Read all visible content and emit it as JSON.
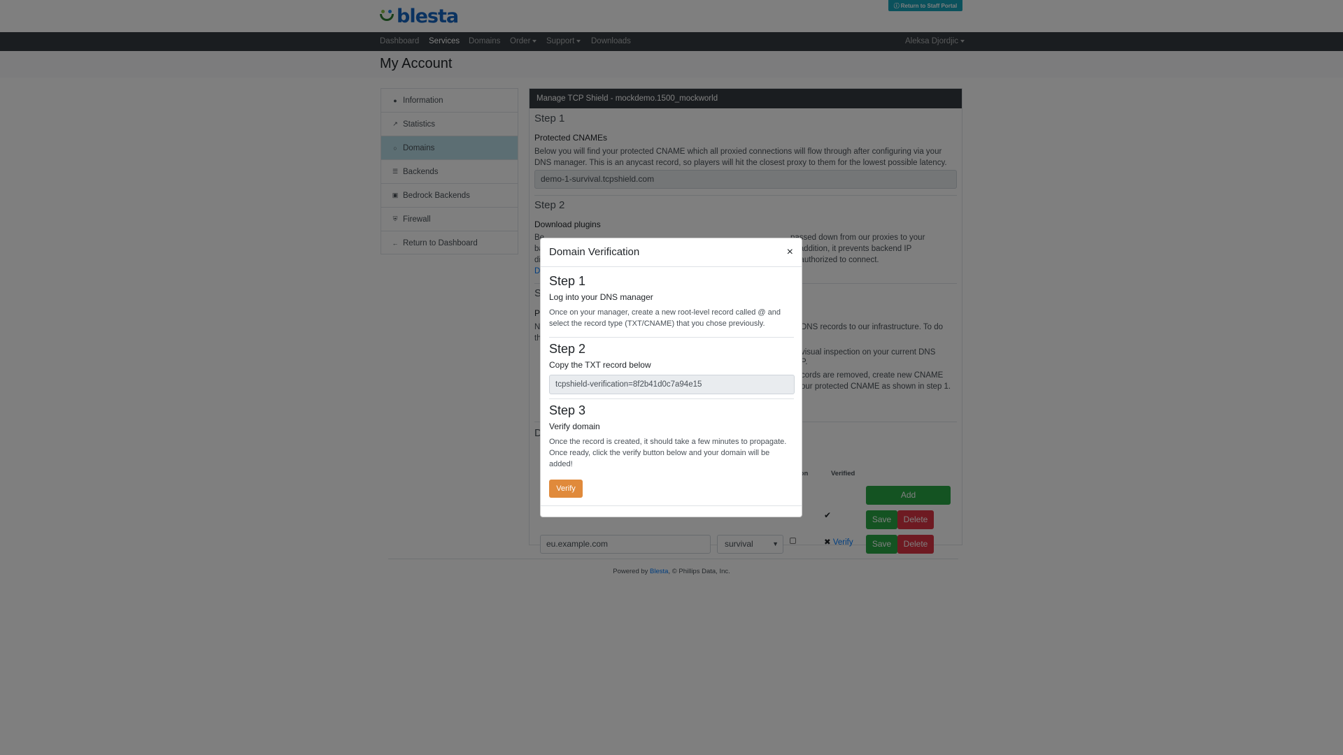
{
  "header": {
    "logo_text": "blesta",
    "staff_portal": "Return to Staff Portal"
  },
  "nav": {
    "items": [
      "Dashboard",
      "Services",
      "Domains",
      "Order",
      "Support",
      "Downloads"
    ],
    "user": "Aleksa Djordjic"
  },
  "page_title": "My Account",
  "sidebar": {
    "items": [
      {
        "label": "Information",
        "icon": "info-circle-icon"
      },
      {
        "label": "Statistics",
        "icon": "chart-line-icon"
      },
      {
        "label": "Domains",
        "icon": "globe-icon"
      },
      {
        "label": "Backends",
        "icon": "server-icon"
      },
      {
        "label": "Bedrock Backends",
        "icon": "cube-icon"
      },
      {
        "label": "Firewall",
        "icon": "shield-icon"
      },
      {
        "label": "Return to Dashboard",
        "icon": "arrow-left-icon"
      }
    ]
  },
  "card": {
    "header": "Manage TCP Shield - mockdemo.1500_mockworld",
    "step1": {
      "title": "Step 1",
      "subtitle": "Protected CNAMEs",
      "text": "Below you will find your protected CNAME which all proxied connections will flow through after configuring via your DNS manager. This is an anycast record, so players will hit the closest proxy to them for the lowest possible latency.",
      "cname": "demo-1-survival.tcpshield.com"
    },
    "step2": {
      "title": "Step 2",
      "subtitle": "Download plugins",
      "line1_a": "Be",
      "line1_b": "passed down from our proxies to your",
      "line2_a": "ba",
      "line2_b": "In addition, it prevents backend IP",
      "line3_a": "di",
      "line3_b": "re authorized to connect.",
      "link_fragment": "D"
    },
    "step3_fragments": {
      "title": "S",
      "sub": "P",
      "l1a": "N",
      "l1b": "DNS records to our infrastructure. To do",
      "l2a": "th",
      "l3": "visual inspection on your current DNS",
      "l4": "P.",
      "l5": "cords are removed, create new CNAME",
      "l6": "our protected CNAME as shown in step 1."
    },
    "domains_fragment": "D",
    "table": {
      "col_ion": "ion",
      "col_verified": "Verified",
      "add_label": "Add",
      "save_label": "Save",
      "delete_label": "Delete",
      "verify_link": "Verify",
      "row_domain": "eu.example.com",
      "row_backend": "survival"
    }
  },
  "footer": {
    "prefix": "Powered by",
    "link": "Blesta",
    "suffix": ", © Phillips Data, Inc."
  },
  "modal": {
    "title": "Domain Verification",
    "close": "×",
    "step1": {
      "title": "Step 1",
      "subtitle": "Log into your DNS manager",
      "text": "Once on your manager, create a new root-level record called @ and select the record type (TXT/CNAME) that you chose previously."
    },
    "step2": {
      "title": "Step 2",
      "subtitle": "Copy the TXT record below",
      "record": "tcpshield-verification=8f2b41d0c7a94e15"
    },
    "step3": {
      "title": "Step 3",
      "subtitle": "Verify domain",
      "text": "Once the record is created, it should take a few minutes to propagate. Once ready, click the verify button below and your domain will be added!"
    },
    "verify_button": "Verify"
  }
}
